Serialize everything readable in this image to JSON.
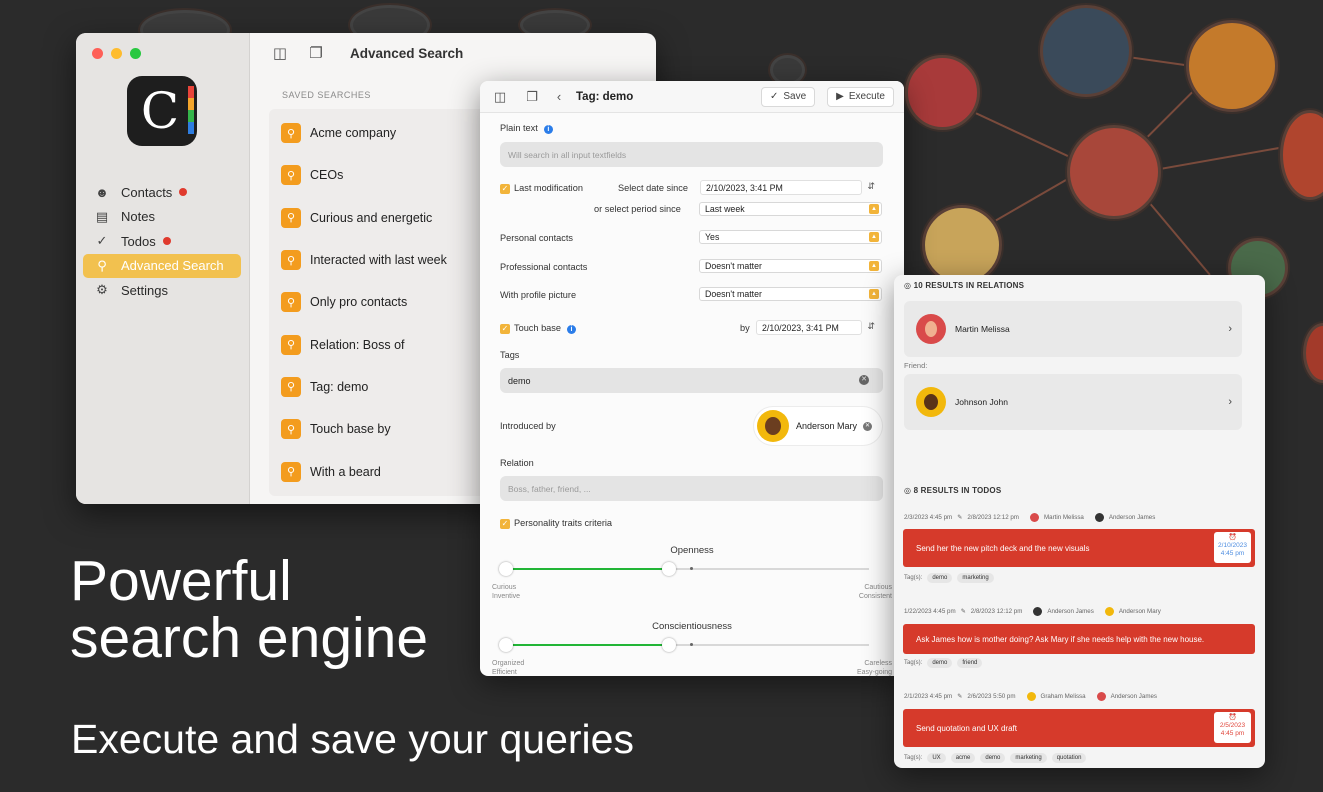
{
  "main_window": {
    "title": "Advanced Search",
    "saved_searches_label": "SAVED SEARCHES",
    "sidebar": [
      {
        "label": "Contacts",
        "icon": "contacts-icon",
        "badge": true
      },
      {
        "label": "Notes",
        "icon": "notes-icon",
        "badge": false
      },
      {
        "label": "Todos",
        "icon": "todos-icon",
        "badge": true
      },
      {
        "label": "Advanced Search",
        "icon": "search-icon",
        "badge": false,
        "active": true
      },
      {
        "label": "Settings",
        "icon": "gear-icon",
        "badge": false
      }
    ],
    "saved_searches": [
      "Acme company",
      "CEOs",
      "Curious and energetic",
      "Interacted with last week",
      "Only pro contacts",
      "Relation: Boss of",
      "Tag: demo",
      "Touch base by",
      "With a beard"
    ]
  },
  "search_window": {
    "title": "Tag: demo",
    "save_label": "Save",
    "execute_label": "Execute",
    "plain_text_label": "Plain text",
    "plain_text_placeholder": "Will search in all input textfields",
    "last_mod_label": "Last modification",
    "select_date_label": "Select date since",
    "date_value": "2/10/2023,   3:41 PM",
    "period_label": "or select period since",
    "period_value": "Last week",
    "personal_label": "Personal contacts",
    "personal_value": "Yes",
    "professional_label": "Professional contacts",
    "professional_value": "Doesn't matter",
    "picture_label": "With profile picture",
    "picture_value": "Doesn't matter",
    "touch_base_label": "Touch base",
    "by_label": "by",
    "touch_date": "2/10/2023,   3:41 PM",
    "tags_label": "Tags",
    "tags_value": "demo",
    "introduced_label": "Introduced by",
    "introduced_name": "Anderson Mary",
    "relation_label": "Relation",
    "relation_placeholder": "Boss, father, friend, ...",
    "personality_label": "Personality traits criteria",
    "sliders": [
      {
        "title": "Openness",
        "left": "Curious\nInventive",
        "right": "Cautious\nConsistent",
        "value": 0.45
      },
      {
        "title": "Conscientiousness",
        "left": "Organized\nEfficient",
        "right": "Careless\nEasy-going",
        "value": 0.45
      }
    ]
  },
  "results_window": {
    "relations_header": "10 RESULTS IN RELATIONS",
    "relations": [
      {
        "name": "Martin Melissa",
        "color": "#d94a4a"
      },
      {
        "name": "Johnson John",
        "color": "#f2b80c"
      }
    ],
    "friend_label": "Friend:",
    "todos_header": "8 RESULTS IN TODOS",
    "todos": [
      {
        "created": "2/3/2023 4:45 pm",
        "edited": "2/8/2023 12:12 pm",
        "p1": "Martin Melissa",
        "p2": "Anderson James",
        "text": "Send her the new pitch deck and the new visuals",
        "alarm": "2/10/2023\n4:45 pm",
        "tags": [
          "demo",
          "marketing"
        ]
      },
      {
        "created": "1/22/2023 4:45 pm",
        "edited": "2/8/2023 12:12 pm",
        "p1": "Anderson James",
        "p2": "Anderson Mary",
        "text": "Ask James how is mother doing? Ask Mary if she needs help with the new house.",
        "alarm": "",
        "tags": [
          "demo",
          "friend"
        ]
      },
      {
        "created": "2/1/2023 4:45 pm",
        "edited": "2/6/2023 5:50 pm",
        "p1": "Graham Melissa",
        "p2": "Anderson James",
        "text": "Send quotation and UX draft",
        "alarm": "2/5/2023\n4:45 pm",
        "tags": [
          "UX",
          "acme",
          "demo",
          "marketing",
          "quotation"
        ]
      }
    ],
    "tags_prefix": "Tag(s):"
  },
  "marketing": {
    "headline_1": "Powerful",
    "headline_2": "search engine",
    "subline": "Execute and save your queries"
  },
  "colors": {
    "accent": "#f2c14f",
    "todo_red": "#d63a2b",
    "saved_icon": "#f39c1e"
  }
}
